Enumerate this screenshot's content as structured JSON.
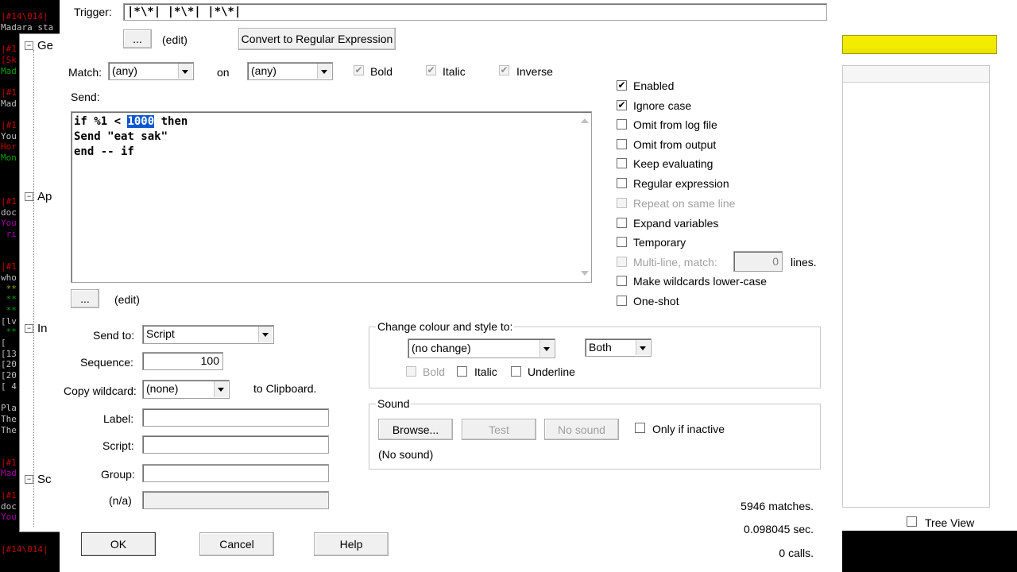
{
  "bg_left": {
    "lines": [
      {
        "t": "|#14\\014|",
        "c": "#c00000"
      },
      {
        "t": "Madara sta",
        "c": "#c0c0c0"
      },
      {
        "t": "",
        "c": "#c0c0c0"
      },
      {
        "t": "|#1",
        "c": "#c00000"
      },
      {
        "t": "[Sk",
        "c": "#c00000"
      },
      {
        "t": "Mad",
        "c": "#00a000"
      },
      {
        "t": "",
        "c": "#c0c0c0"
      },
      {
        "t": "|#1",
        "c": "#c00000"
      },
      {
        "t": "Mad",
        "c": "#c0c0c0"
      },
      {
        "t": "",
        "c": "#c0c0c0"
      },
      {
        "t": "|#1",
        "c": "#c00000"
      },
      {
        "t": "You",
        "c": "#c0c0c0"
      },
      {
        "t": "Hor",
        "c": "#c00000"
      },
      {
        "t": "Mon",
        "c": "#00a000"
      },
      {
        "t": "",
        "c": "#c0c0c0"
      },
      {
        "t": "",
        "c": "#c0c0c0"
      },
      {
        "t": "",
        "c": "#c0c0c0"
      },
      {
        "t": "|#1",
        "c": "#c00000"
      },
      {
        "t": "doc",
        "c": "#c0c0c0"
      },
      {
        "t": "You",
        "c": "#a000a0"
      },
      {
        "t": " ri",
        "c": "#a000a0"
      },
      {
        "t": "",
        "c": "#c0c0c0"
      },
      {
        "t": "",
        "c": "#c0c0c0"
      },
      {
        "t": "|#1",
        "c": "#c00000"
      },
      {
        "t": "who",
        "c": "#c0c0c0"
      },
      {
        "t": " **",
        "c": "#a0a000"
      },
      {
        "t": " **",
        "c": "#00a000"
      },
      {
        "t": " **",
        "c": "#00a000"
      },
      {
        "t": "[lv",
        "c": "#c0c0c0"
      },
      {
        "t": " **",
        "c": "#00a000"
      },
      {
        "t": "[",
        "c": "#c0c0c0"
      },
      {
        "t": "[13",
        "c": "#c0c0c0"
      },
      {
        "t": "[20",
        "c": "#c0c0c0"
      },
      {
        "t": "[20",
        "c": "#c0c0c0"
      },
      {
        "t": "[ 4",
        "c": "#c0c0c0"
      },
      {
        "t": "",
        "c": "#c0c0c0"
      },
      {
        "t": "Pla",
        "c": "#c0c0c0"
      },
      {
        "t": "The",
        "c": "#c0c0c0"
      },
      {
        "t": "The",
        "c": "#c0c0c0"
      },
      {
        "t": "",
        "c": "#c0c0c0"
      },
      {
        "t": "",
        "c": "#c0c0c0"
      },
      {
        "t": "|#1",
        "c": "#c00000"
      },
      {
        "t": "Mad",
        "c": "#a000a0"
      },
      {
        "t": "",
        "c": "#c0c0c0"
      },
      {
        "t": "|#1",
        "c": "#c00000"
      },
      {
        "t": "doc",
        "c": "#c0c0c0"
      },
      {
        "t": "You",
        "c": "#a000a0"
      },
      {
        "t": "",
        "c": "#c0c0c0"
      },
      {
        "t": "",
        "c": "#c0c0c0"
      },
      {
        "t": "|#14\\014|",
        "c": "#c00000"
      }
    ],
    "tree": [
      "Ge",
      "Ap",
      "In",
      "Sc"
    ]
  },
  "trigger": {
    "label": "Trigger:",
    "value": "|*\\*| |*\\*| |*\\*|"
  },
  "edit_btn1": {
    "label": "..."
  },
  "edit_label1": "(edit)",
  "convert_btn": "Convert to Regular Expression",
  "match": {
    "label": "Match:",
    "value": "(any)",
    "on_label": "on",
    "on_value": "(any)",
    "bold": "Bold",
    "italic": "Italic",
    "inverse": "Inverse"
  },
  "send": {
    "label": "Send:",
    "line1_a": "if %1 < ",
    "line1_sel": "1000",
    "line1_b": " then",
    "line2": "Send \"eat sak\"",
    "line3": "end -- if"
  },
  "edit_btn2": {
    "label": "..."
  },
  "edit_label2": "(edit)",
  "send_to": {
    "label": "Send to:",
    "value": "Script"
  },
  "sequence": {
    "label": "Sequence:",
    "value": "100"
  },
  "copy_wildcard": {
    "label": "Copy wildcard:",
    "value": "(none)",
    "suffix": "to Clipboard."
  },
  "label_field": {
    "label": "Label:",
    "value": ""
  },
  "script_field": {
    "label": "Script:",
    "value": ""
  },
  "group_field": {
    "label": "Group:",
    "value": ""
  },
  "na_field": {
    "label": "(n/a)",
    "value": ""
  },
  "options": [
    {
      "label": "Enabled",
      "checked": true,
      "disabled": false
    },
    {
      "label": "Ignore case",
      "checked": true,
      "disabled": false
    },
    {
      "label": "Omit from log file",
      "checked": false,
      "disabled": false
    },
    {
      "label": "Omit from output",
      "checked": false,
      "disabled": false
    },
    {
      "label": "Keep evaluating",
      "checked": false,
      "disabled": false
    },
    {
      "label": "Regular expression",
      "checked": false,
      "disabled": false
    },
    {
      "label": "Repeat on same line",
      "checked": false,
      "disabled": true
    },
    {
      "label": "Expand variables",
      "checked": false,
      "disabled": false
    },
    {
      "label": "Temporary",
      "checked": false,
      "disabled": false
    },
    {
      "label": "Multi-line, match:",
      "checked": false,
      "disabled": true
    },
    {
      "label": "Make wildcards lower-case",
      "checked": false,
      "disabled": false
    },
    {
      "label": "One-shot",
      "checked": false,
      "disabled": false
    }
  ],
  "multiline": {
    "value": "0",
    "suffix": "lines."
  },
  "colour_group": {
    "title": "Change colour and style to:",
    "colour": "(no change)",
    "which": "Both",
    "bold": "Bold",
    "italic": "Italic",
    "underline": "Underline"
  },
  "sound_group": {
    "title": "Sound",
    "browse": "Browse...",
    "test": "Test",
    "no_sound": "No sound",
    "only_inactive": "Only if inactive",
    "current": "(No sound)"
  },
  "stats": {
    "matches": "5946 matches.",
    "time": "0.098045 sec.",
    "calls": "0 calls."
  },
  "buttons": {
    "ok": "OK",
    "cancel": "Cancel",
    "help": "Help"
  },
  "tree_view": "Tree View"
}
